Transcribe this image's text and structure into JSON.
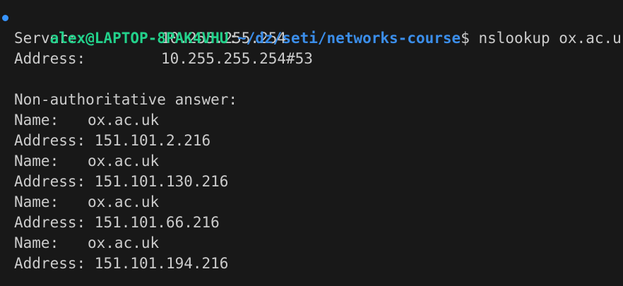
{
  "prompt": {
    "user_host": "alex@LAPTOP-8PAK4VHU",
    "separator": ":",
    "path": "~/dz/seti/networks-course",
    "symbol": "$",
    "command": " nslookup ox.ac.uk"
  },
  "server_info": {
    "server_label": "Server:",
    "server_value": "10.255.255.254",
    "address_label": "Address:",
    "address_value": "10.255.255.254#53"
  },
  "answer_header": "Non-authoritative answer:",
  "records": [
    {
      "name_label": "Name:",
      "name_value": "ox.ac.uk",
      "address_label": "Address: ",
      "address_value": "151.101.2.216"
    },
    {
      "name_label": "Name:",
      "name_value": "ox.ac.uk",
      "address_label": "Address: ",
      "address_value": "151.101.130.216"
    },
    {
      "name_label": "Name:",
      "name_value": "ox.ac.uk",
      "address_label": "Address: ",
      "address_value": "151.101.66.216"
    },
    {
      "name_label": "Name:",
      "name_value": "ox.ac.uk",
      "address_label": "Address: ",
      "address_value": "151.101.194.216"
    }
  ],
  "colors": {
    "background": "#181818",
    "text": "#cccccc",
    "user_host": "#23d18b",
    "path": "#3b8eea",
    "decoration_dot": "#3794ff"
  }
}
